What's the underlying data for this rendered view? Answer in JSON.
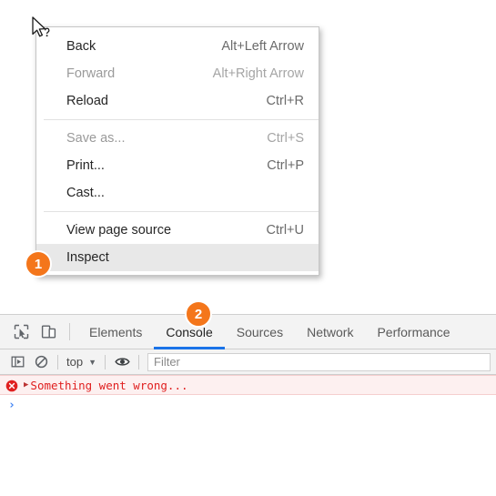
{
  "cursor": {
    "icon": "arrow-help-cursor"
  },
  "context_menu": {
    "items": [
      {
        "label": "Back",
        "shortcut": "Alt+Left Arrow",
        "disabled": false,
        "highlighted": false
      },
      {
        "label": "Forward",
        "shortcut": "Alt+Right Arrow",
        "disabled": true,
        "highlighted": false
      },
      {
        "label": "Reload",
        "shortcut": "Ctrl+R",
        "disabled": false,
        "highlighted": false
      },
      {
        "separator": true
      },
      {
        "label": "Save as...",
        "shortcut": "Ctrl+S",
        "disabled": true,
        "highlighted": false
      },
      {
        "label": "Print...",
        "shortcut": "Ctrl+P",
        "disabled": false,
        "highlighted": false
      },
      {
        "label": "Cast...",
        "shortcut": "",
        "disabled": false,
        "highlighted": false
      },
      {
        "separator": true
      },
      {
        "label": "View page source",
        "shortcut": "Ctrl+U",
        "disabled": false,
        "highlighted": false
      },
      {
        "label": "Inspect",
        "shortcut": "",
        "disabled": false,
        "highlighted": true
      }
    ]
  },
  "badges": [
    {
      "number": "1",
      "target": "inspect-menu-item"
    },
    {
      "number": "2",
      "target": "console-tab"
    }
  ],
  "devtools": {
    "toolbar_icons": [
      {
        "name": "inspect-element-icon"
      },
      {
        "name": "device-toolbar-icon"
      }
    ],
    "tabs": [
      {
        "label": "Elements",
        "active": false
      },
      {
        "label": "Console",
        "active": true
      },
      {
        "label": "Sources",
        "active": false
      },
      {
        "label": "Network",
        "active": false
      },
      {
        "label": "Performance",
        "active": false
      }
    ],
    "console_toolbar": {
      "sidebar_icon": "console-sidebar-icon",
      "clear_icon": "clear-console-icon",
      "context_label": "top",
      "context_caret": "▼",
      "eye_icon": "live-expression-eye-icon",
      "filter_placeholder": "Filter"
    },
    "console_messages": [
      {
        "level": "error",
        "icon": "error-circle-icon",
        "disclosure": "▶",
        "text": "Something went wrong..."
      }
    ],
    "prompt": {
      "caret": "›"
    }
  },
  "colors": {
    "badge_orange": "#f4761b",
    "tab_active_blue": "#1a73e8",
    "error_red": "#e02020",
    "error_bg": "#fdf0f0",
    "prompt_blue": "#4285f4",
    "menu_highlight": "#e8e8e8"
  }
}
